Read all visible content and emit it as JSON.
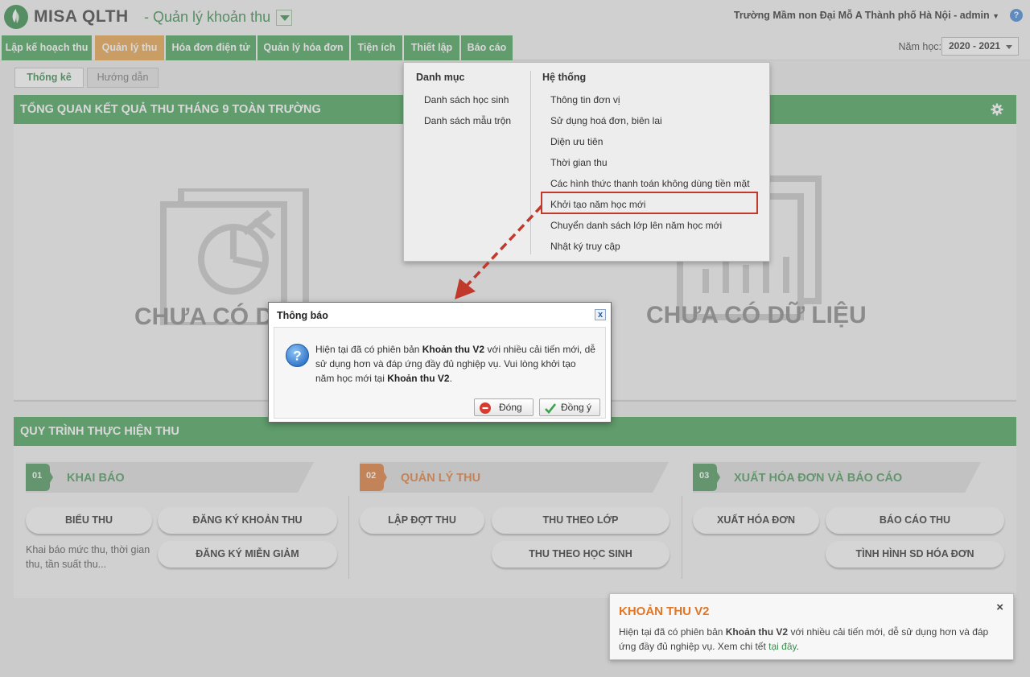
{
  "header": {
    "brand": "MISA QLTH",
    "app_title": "- Quản lý khoản thu",
    "school_user": "Trường Mầm non Đại Mỗ A Thành phố Hà Nội - admin",
    "help": "?"
  },
  "nav": {
    "items": [
      "Lập kế hoạch thu",
      "Quản lý thu",
      "Hóa đơn điện tử",
      "Quản lý hóa đơn",
      "Tiện ích",
      "Thiết lập",
      "Báo cáo"
    ],
    "active_index": 1,
    "year_label": "Năm học:",
    "year_value": "2020 - 2021"
  },
  "subtabs": [
    "Thống kê",
    "Hướng dẫn"
  ],
  "overview": {
    "title": "TỔNG QUAN KẾT QUẢ THU THÁNG 9 TOÀN TRƯỜNG",
    "empty_left": "CHƯA CÓ DỮ",
    "empty_right": "CHƯA CÓ DỮ LIỆU"
  },
  "process": {
    "title": "QUY TRÌNH THỰC HIỆN THU",
    "steps": [
      {
        "num": "01",
        "title": "KHAI BÁO"
      },
      {
        "num": "02",
        "title": "QUẢN LÝ THU"
      },
      {
        "num": "03",
        "title": "XUẤT HÓA ĐƠN VÀ BÁO CÁO"
      }
    ],
    "buttons": {
      "bieu_thu": "BIỂU THU",
      "dang_ky_khoan_thu": "ĐĂNG KÝ KHOẢN THU",
      "dang_ky_mien_giam": "ĐĂNG KÝ MIỄN GIẢM",
      "lap_dot_thu": "LẬP ĐỢT THU",
      "thu_theo_lop": "THU THEO LỚP",
      "thu_theo_hoc_sinh": "THU THEO HỌC SINH",
      "xuat_hoa_don": "XUẤT HÓA ĐƠN",
      "bao_cao_thu": "BÁO CÁO THU",
      "tinh_hinh_sd": "TÌNH HÌNH SD HÓA ĐƠN"
    },
    "desc": "Khai báo mức thu, thời gian thu, tần suất thu..."
  },
  "menu": {
    "col1_head": "Danh mục",
    "col1_items": [
      "Danh sách học sinh",
      "Danh sách mẫu trộn"
    ],
    "col2_head": "Hệ thống",
    "col2_items": [
      "Thông tin đơn vị",
      "Sử dụng hoá đơn, biên lai",
      "Diện ưu tiên",
      "Thời gian thu",
      "Các hình thức thanh toán không dùng tiền mặt",
      "Khởi tạo năm học mới",
      "Chuyển danh sách lớp lên năm học mới",
      "Nhật ký truy cập"
    ],
    "highlighted_item": "Khởi tạo năm học mới"
  },
  "dialog": {
    "title": "Thông báo",
    "close": "x",
    "msg_1": "Hiện tại đã có phiên bản ",
    "msg_bold_1": "Khoản thu V2",
    "msg_2": " với nhiều cải tiến mới, dễ sử dụng hơn và đáp ứng đầy đủ nghiệp vụ. Vui lòng khởi tạo năm học mới tại ",
    "msg_bold_2": "Khoản thu V2",
    "msg_3": ".",
    "close_btn": "Đóng",
    "ok_btn": "Đồng ý"
  },
  "toast": {
    "title": "KHOẢN THU V2",
    "close": "×",
    "msg_1": "Hiện tại đã có phiên bản ",
    "msg_bold": "Khoản thu V2",
    "msg_2": " với nhiều cải tiến mới, dễ sử dụng hơn và đáp ứng đầy đủ nghiệp vụ. Xem chi tết ",
    "link": "tại đây",
    "msg_3": "."
  },
  "colors": {
    "green": "#49a55c",
    "active_tab": "#e9a64e",
    "step1": "#4f9a5e",
    "step2": "#e07f3e",
    "step3": "#4f9a5e",
    "highlight": "#c0392b",
    "toast_title": "#e07626"
  },
  "icons": [
    "misa-logo-icon",
    "dropdown-icon",
    "help-icon",
    "gear-icon",
    "question-icon",
    "close-icon",
    "cancel-icon",
    "check-icon",
    "arrow-icon"
  ]
}
